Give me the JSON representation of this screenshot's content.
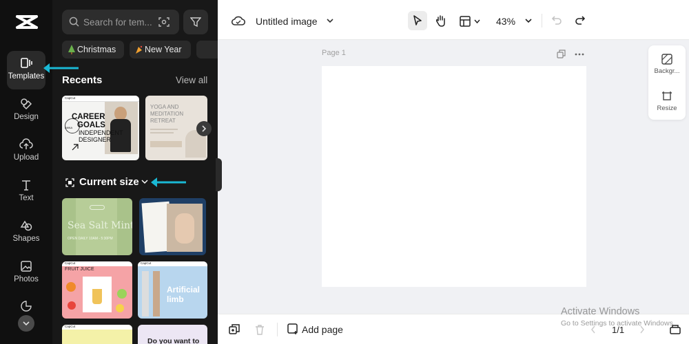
{
  "sidebar": {
    "items": [
      {
        "label": "Templates",
        "icon": "templates-icon"
      },
      {
        "label": "Design",
        "icon": "design-icon"
      },
      {
        "label": "Upload",
        "icon": "upload-icon"
      },
      {
        "label": "Text",
        "icon": "text-icon"
      },
      {
        "label": "Shapes",
        "icon": "shapes-icon"
      },
      {
        "label": "Photos",
        "icon": "photos-icon"
      }
    ]
  },
  "panel": {
    "search_placeholder": "Search for tem...",
    "chips": [
      "Christmas",
      "New Year"
    ],
    "recents_title": "Recents",
    "view_all": "View all",
    "current_size": "Current size",
    "templates": {
      "career": {
        "brand": "CapCut",
        "l1": "CAREER",
        "l2": "GOALS",
        "l3": "INDEPENDENT",
        "l4": "DESIGNER",
        "name": "ANNA"
      },
      "yoga": {
        "l1": "YOGA AND",
        "l2": "MEDITATION",
        "l3": "RETREAT"
      },
      "sea": {
        "l1": "Sea Salt Mint",
        "l2": "OPEN DAILY 10AM - 5:30PM"
      },
      "juice": {
        "brand": "CapCut",
        "l1": "FRUIT JUICE"
      },
      "limb": {
        "brand": "CapCut",
        "l1": "Artificial",
        "l2": "limb"
      },
      "bottom": {
        "brand": "CapCut",
        "l1": "Do you want to"
      }
    }
  },
  "toolbar": {
    "title": "Untitled image",
    "zoom": "43%"
  },
  "canvas": {
    "page_label": "Page 1"
  },
  "right_panel": {
    "background": "Backgr...",
    "resize": "Resize"
  },
  "bottom": {
    "add_page": "Add page",
    "page_indicator": "1/1"
  },
  "watermark": {
    "line1": "Activate Windows",
    "line2": "Go to Settings to activate Windows."
  },
  "colors": {
    "annotation_arrow": "#1ab8d4",
    "panel_bg": "#181818",
    "rail_bg": "#101010"
  }
}
